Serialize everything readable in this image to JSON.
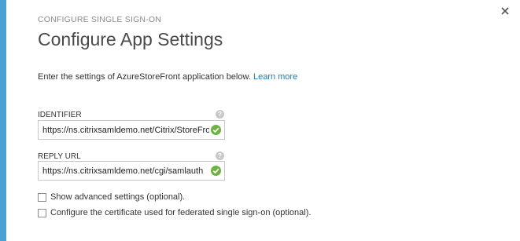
{
  "dialog": {
    "kicker": "CONFIGURE SINGLE SIGN-ON",
    "title": "Configure App Settings",
    "intro_text": "Enter the settings of AzureStoreFront application below.",
    "learn_more": "Learn more",
    "close_icon": "close-icon",
    "accent_color": "#4aa1d6"
  },
  "fields": {
    "identifier": {
      "label": "IDENTIFIER",
      "value": "https://ns.citrixsamldemo.net/Citrix/StoreFront",
      "status_icon": "valid-check-icon",
      "help_icon": "help-icon"
    },
    "reply_url": {
      "label": "REPLY URL",
      "value": "https://ns.citrixsamldemo.net/cgi/samlauth",
      "status_icon": "valid-check-icon",
      "help_icon": "help-icon"
    }
  },
  "options": {
    "advanced": "Show advanced settings (optional).",
    "certificate": "Configure the certificate used for federated single sign-on (optional)."
  }
}
